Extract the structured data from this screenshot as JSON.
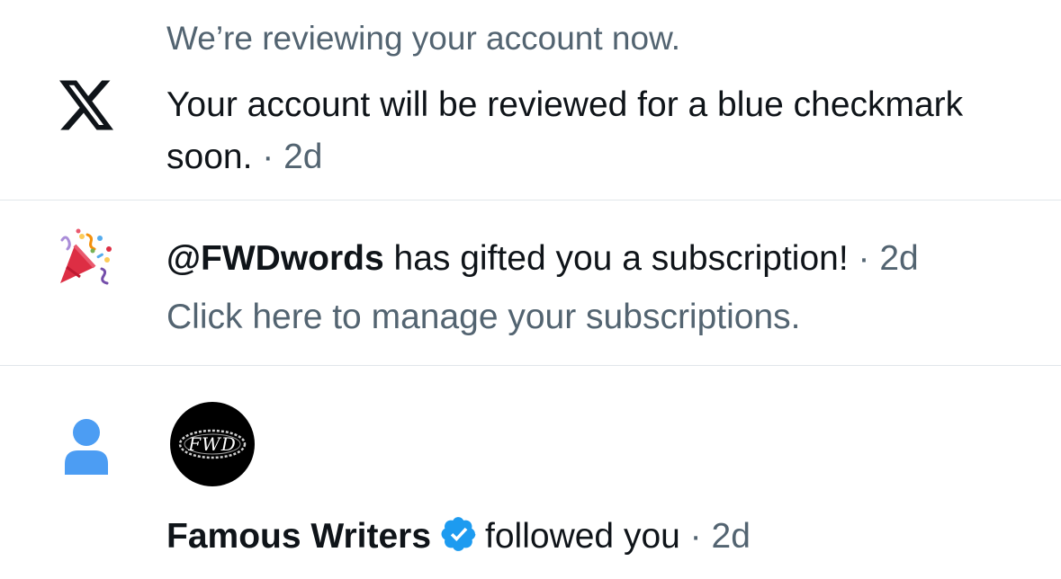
{
  "notifications": [
    {
      "preface": "We’re reviewing your account now.",
      "icon": "x-logo-icon",
      "message": "Your account will be reviewed for a blue checkmark soon.",
      "separator": " · ",
      "time": "2d"
    },
    {
      "icon": "party-popper-icon",
      "handle": "@FWDwords",
      "message": " has gifted you a subscription!",
      "separator": " · ",
      "time": "2d",
      "subtext": "Click here to manage your subscriptions."
    },
    {
      "icon": "person-icon",
      "avatar_logo": "FWD",
      "actor": "Famous Writers",
      "actor_verified": true,
      "message": "followed you",
      "separator": " · ",
      "time": "2d"
    }
  ],
  "colors": {
    "text_primary": "#0f1419",
    "text_secondary": "#536471",
    "divider": "#e1e6ea",
    "verified_blue": "#1d9bf0",
    "person_icon_blue": "#4c9df3",
    "party_popper_red": "#dd2e44"
  }
}
